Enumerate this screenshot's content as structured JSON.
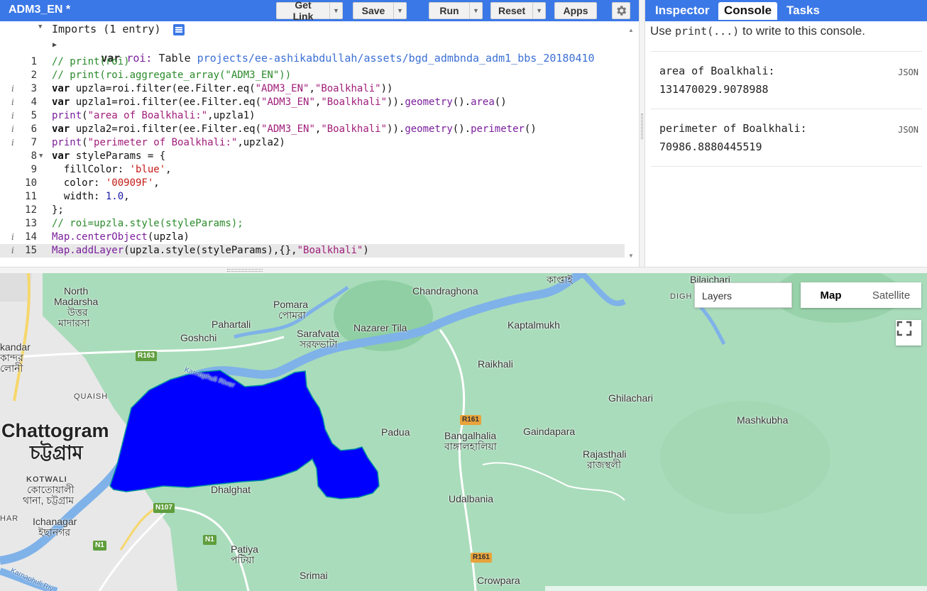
{
  "editor": {
    "title": "ADM3_EN *",
    "buttons": {
      "get_link": "Get Link",
      "save": "Save",
      "run": "Run",
      "reset": "Reset",
      "apps": "Apps"
    },
    "imports_header": "Imports (1 entry)",
    "import_line": {
      "kw": "var",
      "name": "roi:",
      "type": "Table",
      "path": "projects/ee-ashikabdullah/assets/bgd_admbnda_adm1_bbs_20180410"
    },
    "lines": [
      {
        "n": "1",
        "parts": [
          [
            "c-com",
            "// print(roi)"
          ]
        ]
      },
      {
        "n": "2",
        "parts": [
          [
            "c-com",
            "// print(roi.aggregate_array(\"ADM3_EN\"))"
          ]
        ]
      },
      {
        "n": "3",
        "info": true,
        "parts": [
          [
            "c-kw",
            "var "
          ],
          [
            "c-prop",
            "upzla=roi.filter(ee.Filter.eq("
          ],
          [
            "c-str2",
            "\"ADM3_EN\""
          ],
          [
            "c-prop",
            ","
          ],
          [
            "c-str2",
            "\"Boalkhali\""
          ],
          [
            "c-prop",
            "))"
          ]
        ]
      },
      {
        "n": "4",
        "info": true,
        "parts": [
          [
            "c-kw",
            "var "
          ],
          [
            "c-prop",
            "upzla1=roi.filter(ee.Filter.eq("
          ],
          [
            "c-str2",
            "\"ADM3_EN\""
          ],
          [
            "c-prop",
            ","
          ],
          [
            "c-str2",
            "\"Boalkhali\""
          ],
          [
            "c-prop",
            "))."
          ],
          [
            "c-fn",
            "geometry"
          ],
          [
            "c-prop",
            "()."
          ],
          [
            "c-fn",
            "area"
          ],
          [
            "c-prop",
            "()"
          ]
        ]
      },
      {
        "n": "5",
        "info": true,
        "parts": [
          [
            "c-fn",
            "print"
          ],
          [
            "c-prop",
            "("
          ],
          [
            "c-str2",
            "\"area of Boalkhali:\""
          ],
          [
            "c-prop",
            ",upzla1)"
          ]
        ]
      },
      {
        "n": "6",
        "info": true,
        "parts": [
          [
            "c-kw",
            "var "
          ],
          [
            "c-prop",
            "upzla2=roi.filter(ee.Filter.eq("
          ],
          [
            "c-str2",
            "\"ADM3_EN\""
          ],
          [
            "c-prop",
            ","
          ],
          [
            "c-str2",
            "\"Boalkhali\""
          ],
          [
            "c-prop",
            "))."
          ],
          [
            "c-fn",
            "geometry"
          ],
          [
            "c-prop",
            "()."
          ],
          [
            "c-fn",
            "perimeter"
          ],
          [
            "c-prop",
            "()"
          ]
        ]
      },
      {
        "n": "7",
        "info": true,
        "parts": [
          [
            "c-fn",
            "print"
          ],
          [
            "c-prop",
            "("
          ],
          [
            "c-str2",
            "\"perimeter of Boalkhali:\""
          ],
          [
            "c-prop",
            ",upzla2)"
          ]
        ]
      },
      {
        "n": "8",
        "fold": true,
        "parts": [
          [
            "c-kw",
            "var "
          ],
          [
            "c-prop",
            "styleParams = {"
          ]
        ]
      },
      {
        "n": "9",
        "parts": [
          [
            "c-prop",
            "  fillColor: "
          ],
          [
            "c-str",
            "'blue'"
          ],
          [
            "c-prop",
            ","
          ]
        ]
      },
      {
        "n": "10",
        "parts": [
          [
            "c-prop",
            "  color: "
          ],
          [
            "c-str",
            "'00909F'"
          ],
          [
            "c-prop",
            ","
          ]
        ]
      },
      {
        "n": "11",
        "parts": [
          [
            "c-prop",
            "  width: "
          ],
          [
            "c-num",
            "1.0"
          ],
          [
            "c-prop",
            ","
          ]
        ]
      },
      {
        "n": "12",
        "parts": [
          [
            "c-prop",
            "};"
          ]
        ]
      },
      {
        "n": "13",
        "parts": [
          [
            "c-com",
            "// roi=upzla.style(styleParams);"
          ]
        ]
      },
      {
        "n": "14",
        "info": true,
        "parts": [
          [
            "c-fn",
            "Map.centerObject"
          ],
          [
            "c-prop",
            "(upzla)"
          ]
        ]
      },
      {
        "n": "15",
        "info": true,
        "active": true,
        "parts": [
          [
            "c-fn",
            "Map.addLayer"
          ],
          [
            "c-prop",
            "(upzla.style(styleParams),{},"
          ],
          [
            "c-str2",
            "\"Boalkhali\""
          ],
          [
            "c-prop",
            ")"
          ]
        ]
      }
    ]
  },
  "right": {
    "tabs": {
      "inspector": "Inspector",
      "console": "Console",
      "tasks": "Tasks"
    },
    "hint_prefix": "Use ",
    "hint_code": "print(...)",
    "hint_suffix": " to write to this console.",
    "entries": [
      {
        "key": "area of Boalkhali:",
        "value": "131470029.9078988",
        "tag": "JSON"
      },
      {
        "key": "perimeter of Boalkhali:",
        "value": "70986.8880445519",
        "tag": "JSON"
      }
    ]
  },
  "map": {
    "layers_label": "Layers",
    "map_label": "Map",
    "satellite_label": "Satellite",
    "places": {
      "north_madarsha": "North",
      "north_madarsha2": "Madarsha",
      "north_madarsha_bn": "উত্তর",
      "north_madarsha_bn2": "মাদারসা",
      "pomara": "Pomara",
      "pomara_bn": "পোমরা",
      "pahartali": "Pahartali",
      "goshchi": "Goshchi",
      "sarafvata": "Sarafvata",
      "sarafvata_bn": "সরফভাটা",
      "nazarer_tila": "Nazarer Tila",
      "chandraghona": "Chandraghona",
      "kaptai_bn": "কাপ্তাই",
      "kaptalmukh": "Kaptalmukh",
      "bilaichari": "Bilaichari",
      "dighi": "DIGH",
      "raikhali": "Raikhali",
      "ghilachari": "Ghilachari",
      "mashkubha": "Mashkubha",
      "padua": "Padua",
      "bangalhalia": "Bangalhalia",
      "bangalhalia_bn": "বাঙ্গালহালিয়া",
      "gaindapara": "Gaindapara",
      "rajasthali": "Rajasthali",
      "rajasthali_bn": "রাজস্থলী",
      "udalbania": "Udalbania",
      "chattogram": "Chattogram",
      "chattogram_bn": "চট্টগ্রাম",
      "quaish": "QUAISH",
      "kandar": "kandar",
      "kandar_bn": "কান্দর",
      "loni": "লোনী",
      "kotwali": "KOTWALI",
      "kotwali_bn": "কোতোয়ালী",
      "thana_bn": "থানা, চট্টগ্রাম",
      "har": "HAR",
      "dhalghat": "Dhalghat",
      "ichanagar": "Ichanagar",
      "ichanagar_bn": "ইছানগর",
      "patiya": "Patiya",
      "patiya_bn": "পটিয়া",
      "srimai": "Srimai",
      "crowpara": "Crowpara",
      "karnaphuli_river": "Karnaphuli River",
      "karnaphuli_river2": "Karnaphuli Riv"
    },
    "roads": {
      "r163": "R163",
      "r161a": "R161",
      "r161b": "R161",
      "n107": "N107",
      "n1a": "N1",
      "n1b": "N1"
    },
    "layer_fill": "#0000ff",
    "layer_stroke": "#00909f"
  }
}
